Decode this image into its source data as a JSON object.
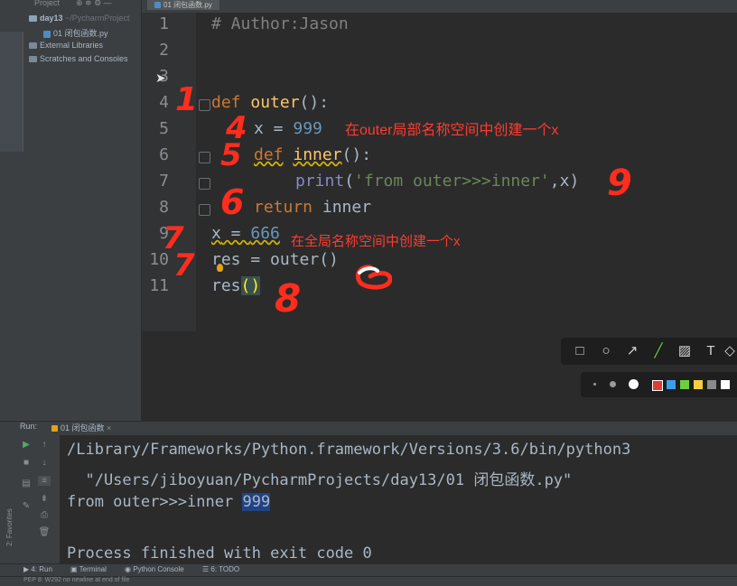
{
  "project": {
    "header": "Project",
    "items": [
      "day13",
      "01 闭包函数.py",
      "External Libraries",
      "Scratches and Consoles"
    ],
    "root_path": "~/PycharmProject"
  },
  "editor": {
    "tab": "01 闭包函数.py",
    "line_numbers": [
      "1",
      "2",
      "3",
      "4",
      "5",
      "6",
      "7",
      "8",
      "9",
      "10",
      "11"
    ],
    "lines": {
      "l1": "# Author:Jason",
      "l4_kw": "def",
      "l4_fn": "outer",
      "l4_rest": "():",
      "l5_var": "x",
      "l5_eq": " = ",
      "l5_num": "999",
      "l6_kw": "def",
      "l6_fn": "inner",
      "l6_rest": "():",
      "l7_bi": "print",
      "l7_open": "(",
      "l7_str": "'from outer>>>inner'",
      "l7_rest": ",x)",
      "l8_kw": "return",
      "l8_rest": " inner",
      "l9_var": "x",
      "l9_eq": " = ",
      "l9_num": "666",
      "l10": "res = outer()",
      "l11_a": "res",
      "l11_b": "()"
    }
  },
  "annotations": {
    "outer_note": "在outer局部名称空间中创建一个x",
    "global_note": "在全局名称空间中创建一个x",
    "handwritten": [
      "1",
      "4",
      "5",
      "6",
      "7",
      "7",
      "8",
      "9"
    ]
  },
  "markup_toolbar": {
    "tools": [
      "rectangle-icon",
      "ellipse-icon",
      "arrow-icon",
      "line-icon",
      "mosaic-icon",
      "text-icon",
      "eraser-icon"
    ],
    "colors": [
      "#e03c31",
      "#3d9ee8",
      "#6cd03e",
      "#f4d03f",
      "#8a8a8a",
      "#ffffff"
    ]
  },
  "run": {
    "label": "Run:",
    "tab": "01 闭包函数",
    "output": {
      "line1": "/Library/Frameworks/Python.framework/Versions/3.6/bin/python3",
      "line2": "  \"/Users/jiboyuan/PycharmProjects/day13/01 闭包函数.py\"",
      "line3_prefix": "from outer>>>inner ",
      "line3_value": "999",
      "line5": "Process finished with exit code 0"
    }
  },
  "bottom_tabs": [
    "4: Run",
    "Terminal",
    "Python Console",
    "6: TODO"
  ],
  "favorites": "2: Favorites",
  "status": "PEP 8: W292 no newline at end of file"
}
